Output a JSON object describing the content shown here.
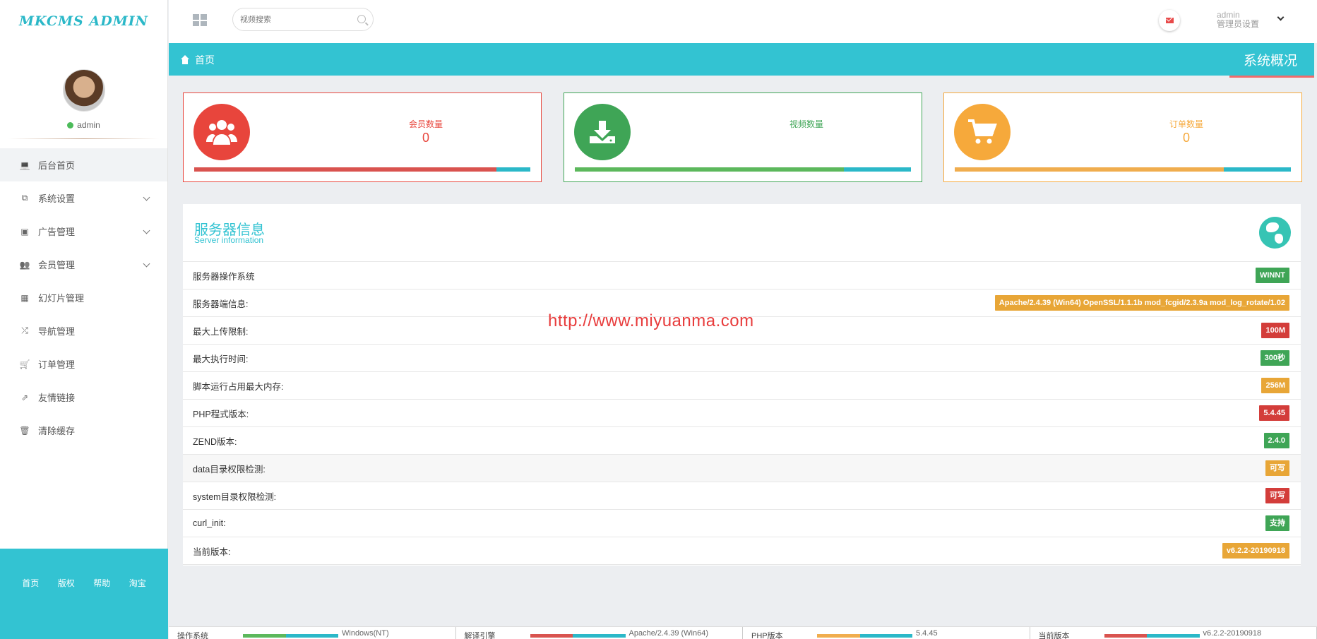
{
  "app": {
    "logo": "MKCMS ADMIN"
  },
  "profile": {
    "username": "admin"
  },
  "sidebar": {
    "items": [
      {
        "label": "后台首页",
        "icon": "laptop-icon",
        "active": true,
        "expandable": false
      },
      {
        "label": "系统设置",
        "icon": "copy-icon",
        "active": false,
        "expandable": true
      },
      {
        "label": "广告管理",
        "icon": "image-icon",
        "active": false,
        "expandable": true
      },
      {
        "label": "会员管理",
        "icon": "users-icon",
        "active": false,
        "expandable": true
      },
      {
        "label": "幻灯片管理",
        "icon": "table-icon",
        "active": false,
        "expandable": false
      },
      {
        "label": "导航管理",
        "icon": "shuffle-icon",
        "active": false,
        "expandable": false
      },
      {
        "label": "订单管理",
        "icon": "cart-icon",
        "active": false,
        "expandable": false
      },
      {
        "label": "友情链接",
        "icon": "external-link-icon",
        "active": false,
        "expandable": false
      },
      {
        "label": "清除缓存",
        "icon": "trash-icon",
        "active": false,
        "expandable": false
      }
    ],
    "footer_links": [
      "首页",
      "版权",
      "帮助",
      "淘宝"
    ]
  },
  "topbar": {
    "search_placeholder": "视频搜索",
    "admin_name": "admin",
    "admin_sub": "管理员设置"
  },
  "breadcrumb": {
    "home": "首页",
    "page_title": "系统概况"
  },
  "stats": [
    {
      "label": "会员数量",
      "value": "0",
      "color": "#e8453c",
      "bar_color": "#d9534f",
      "fill": 0.9,
      "icon": "users-icon"
    },
    {
      "label": "视频数量",
      "value": "",
      "color": "#3fa556",
      "bar_color": "#5cb85c",
      "fill": 0.8,
      "icon": "download-icon"
    },
    {
      "label": "订单数量",
      "value": "0",
      "color": "#f6a93b",
      "bar_color": "#f0ad4e",
      "fill": 0.8,
      "icon": "cart-icon"
    }
  ],
  "server": {
    "title": "服务器信息",
    "subtitle": "Server information",
    "rows": [
      {
        "label": "服务器操作系统",
        "value": "WINNT",
        "color": "green"
      },
      {
        "label": "服务器端信息:",
        "value": "Apache/2.4.39 (Win64) OpenSSL/1.1.1b mod_fcgid/2.3.9a mod_log_rotate/1.02",
        "color": "orange"
      },
      {
        "label": "最大上传限制:",
        "value": "100M",
        "color": "red"
      },
      {
        "label": "最大执行时间:",
        "value": "300秒",
        "color": "green"
      },
      {
        "label": "脚本运行占用最大内存:",
        "value": "256M",
        "color": "orange"
      },
      {
        "label": "PHP程式版本:",
        "value": "5.4.45",
        "color": "red"
      },
      {
        "label": "ZEND版本:",
        "value": "2.4.0",
        "color": "green"
      },
      {
        "label": "data目录权限检测:",
        "value": "可写",
        "color": "orange"
      },
      {
        "label": "system目录权限检测:",
        "value": "可写",
        "color": "red"
      },
      {
        "label": "curl_init:",
        "value": "支持",
        "color": "green"
      },
      {
        "label": "当前版本:",
        "value": "v6.2.2-20190918",
        "color": "orange"
      }
    ]
  },
  "watermark": "http://www.miyuanma.com",
  "bottom_strip": [
    {
      "label": "操作系统",
      "value": "Windows(NT)",
      "color": "#5cb85c"
    },
    {
      "label": "解译引擎",
      "value": "Apache/2.4.39 (Win64)",
      "color": "#d9534f"
    },
    {
      "label": "PHP版本",
      "value": "5.4.45",
      "color": "#f0ad4e"
    },
    {
      "label": "当前版本",
      "value": "v6.2.2-20190918",
      "color": "#d9534f"
    }
  ]
}
